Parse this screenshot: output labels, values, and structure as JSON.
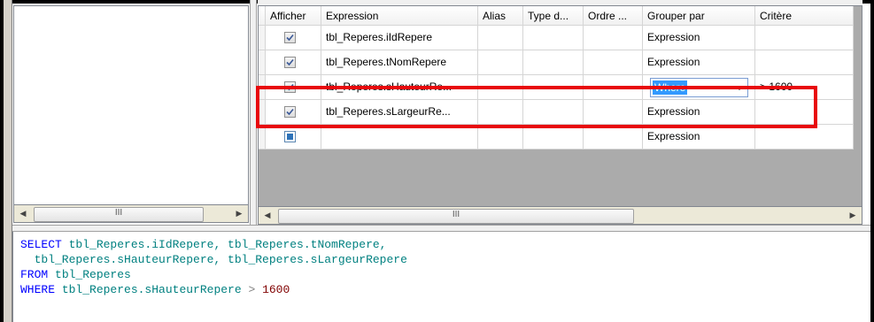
{
  "grid": {
    "columns": [
      "Afficher",
      "Expression",
      "Alias",
      "Type d...",
      "Ordre ...",
      "Grouper par",
      "Critère"
    ],
    "rows": [
      {
        "checked": true,
        "expression": "tbl_Reperes.iIdRepere",
        "group_by": "Expression",
        "criteria": ""
      },
      {
        "checked": true,
        "expression": "tbl_Reperes.tNomRepere",
        "group_by": "Expression",
        "criteria": ""
      },
      {
        "checked": true,
        "expression": "tbl_Reperes.sHauteurRe...",
        "group_by": "Where",
        "criteria": "> 1600",
        "editing": true
      },
      {
        "checked": true,
        "expression": "tbl_Reperes.sLargeurRe...",
        "group_by": "Expression",
        "criteria": ""
      },
      {
        "checked": false,
        "expression": "",
        "group_by": "Expression",
        "criteria": ""
      }
    ]
  },
  "scrollbars": {
    "left_thumb_label": "III",
    "right_thumb_label": "III"
  },
  "sql": {
    "line1_kw": "SELECT",
    "line1_rest": " tbl_Reperes.iIdRepere, tbl_Reperes.tNomRepere,",
    "line2": "  tbl_Reperes.sHauteurRepere, tbl_Reperes.sLargeurRepere",
    "line3_kw": "FROM",
    "line3_rest": " tbl_Reperes",
    "line4_kw": "WHERE",
    "line4_rest": " tbl_Reperes.sHauteurRepere ",
    "line4_op": ">",
    "line4_num": " 1600"
  },
  "colors": {
    "highlight": "#e8070b",
    "selection": "#3399ff",
    "sql_keyword": "#0000ff",
    "sql_identifier": "#008080"
  }
}
